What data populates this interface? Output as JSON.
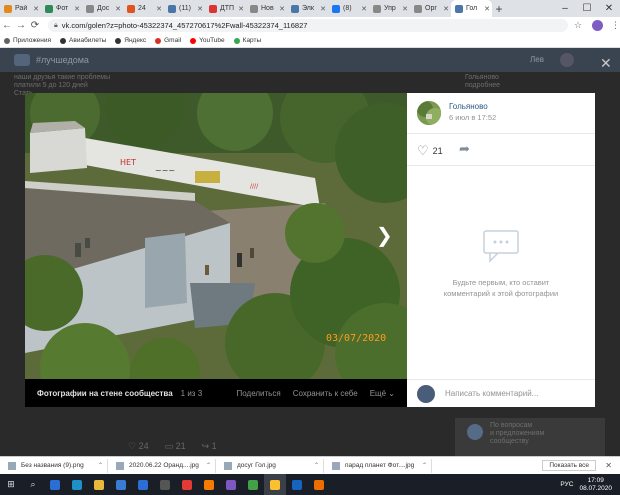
{
  "browser": {
    "tabs": [
      {
        "title": "Рай",
        "color": "#e08a1e"
      },
      {
        "title": "Фот",
        "color": "#2e8b57"
      },
      {
        "title": "Дос",
        "color": "#888888"
      },
      {
        "title": "24",
        "color": "#e0531e"
      },
      {
        "title": "(11)",
        "color": "#4a76a8"
      },
      {
        "title": "ДТП",
        "color": "#d33"
      },
      {
        "title": "Нов",
        "color": "#888888"
      },
      {
        "title": "Элк",
        "color": "#4a76a8"
      },
      {
        "title": "(8)",
        "color": "#1877f2"
      },
      {
        "title": "Упр",
        "color": "#888888"
      },
      {
        "title": "Орг",
        "color": "#888888"
      },
      {
        "title": "Гол",
        "color": "#4a76a8",
        "active": true
      }
    ],
    "new_tab": "+",
    "url": "vk.com/golen?z=photo-45322374_457270617%2Fwall-45322374_116827",
    "bookmarks": [
      {
        "label": "Приложения",
        "color": "#5f6368"
      },
      {
        "label": "Авиабилеты",
        "color": "#333333"
      },
      {
        "label": "Яндекс",
        "color": "#333333"
      },
      {
        "label": "Gmail",
        "color": "#d93025"
      },
      {
        "label": "YouTube",
        "color": "#ff0000"
      },
      {
        "label": "Карты",
        "color": "#34a853"
      }
    ]
  },
  "vk": {
    "search": "#лучшедома",
    "user": "Лев",
    "bg_left_text": "наши друзья такие проблемы\nплатили 5 до 120 дней\nСтать",
    "bg_right_text": "Гольяново\nподробнее",
    "bg_card_text": "По вопросам\nи предложениям\nсообществу",
    "bg_likes": "24",
    "bg_comments": "21",
    "bg_shares": "1"
  },
  "viewer": {
    "photo_date_stamp": "03/07/2020",
    "album_label": "Фотографии на стене сообщества",
    "counter": "1 из 3",
    "share_label": "Поделиться",
    "save_label": "Сохранить к себе",
    "more_label": "Ещё",
    "owner_name": "Гольяново",
    "owner_date": "6 июл в 17:52",
    "likes": "21",
    "empty_comments": "Будьте первым, кто оставит комментарий к этой фотографии",
    "comment_placeholder": "Написать комментарий..."
  },
  "downloads": {
    "items": [
      {
        "name": "Без названия (9).png"
      },
      {
        "name": "2020.06.22 Оранд....jpg"
      },
      {
        "name": "досуг Гол.jpg"
      },
      {
        "name": "парад планет Фот....jpg"
      }
    ],
    "show_all": "Показать все"
  },
  "taskbar": {
    "lang": "РУС",
    "time": "17:09",
    "date": "08.07.2020"
  }
}
